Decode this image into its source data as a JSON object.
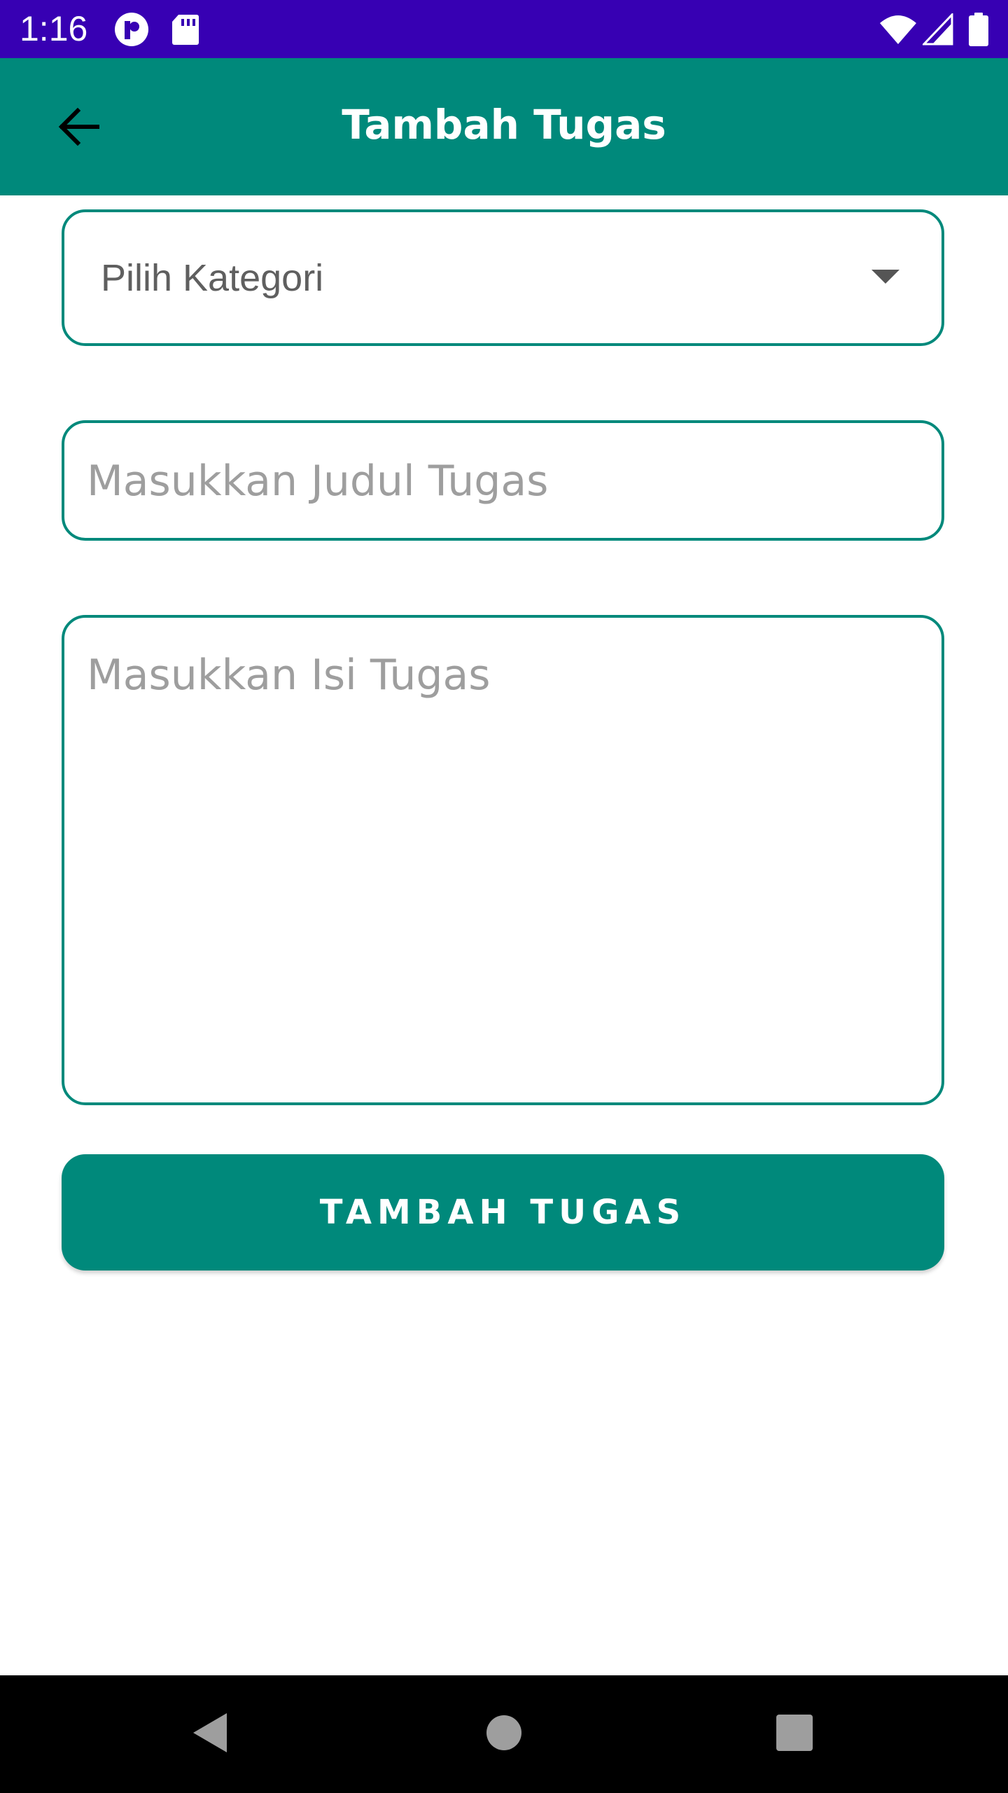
{
  "status_bar": {
    "time": "1:16",
    "icons": [
      "app-notification-icon",
      "sd-card-icon",
      "wifi-icon",
      "signal-icon",
      "battery-icon"
    ]
  },
  "app_bar": {
    "title": "Tambah Tugas",
    "back_icon": "arrow-back-icon"
  },
  "form": {
    "category": {
      "selected": "Pilih Kategori"
    },
    "title_input": {
      "value": "",
      "placeholder": "Masukkan Judul Tugas"
    },
    "body_input": {
      "value": "",
      "placeholder": "Masukkan Isi Tugas"
    },
    "submit_label": "TAMBAH TUGAS"
  },
  "colors": {
    "status_bar": "#3700b3",
    "primary": "#00897b",
    "nav_bar": "#000000"
  },
  "nav_bar": {
    "icons": [
      "back-triangle-icon",
      "home-circle-icon",
      "recents-square-icon"
    ]
  }
}
